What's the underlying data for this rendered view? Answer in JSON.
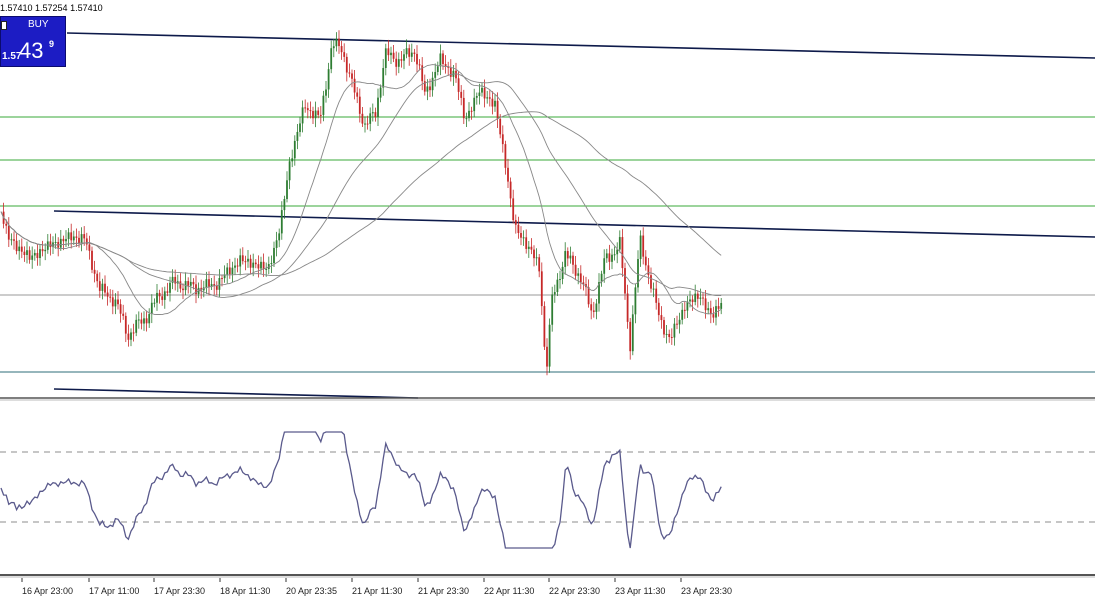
{
  "header": {
    "ohlc_text": "1.57410 1.57254 1.57410"
  },
  "trade_panel": {
    "buy_label": "BUY",
    "price_prefix": "1.57",
    "price_big": "43",
    "price_superscript": "9"
  },
  "chart_data": {
    "type": "line",
    "x_tick_labels": [
      "16 Apr 23:00",
      "17 Apr 11:00",
      "17 Apr 23:30",
      "18 Apr 11:30",
      "20 Apr 23:35",
      "21 Apr 11:30",
      "21 Apr 23:30",
      "22 Apr 11:30",
      "22 Apr 23:30",
      "23 Apr 11:30",
      "23 Apr 23:30"
    ],
    "colors": {
      "bull": "#2e7d32",
      "bear": "#c62828",
      "ma": "#888888",
      "trendline": "#0d1a4a",
      "level_green": "#3aa83a",
      "level_gray": "#9a9a9a",
      "level_teal": "#2e6d7a",
      "oscillator": "#5a5a8c",
      "osc_level": "#8c8c8c"
    }
  }
}
